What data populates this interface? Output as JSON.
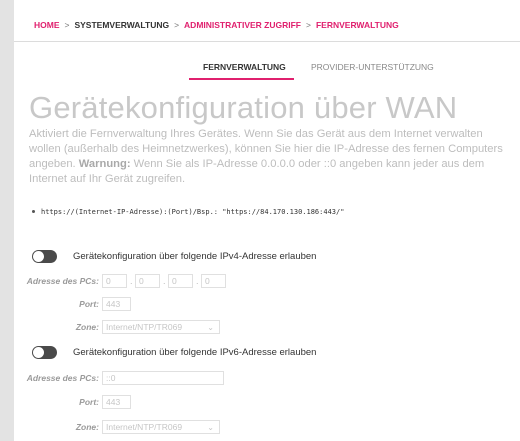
{
  "breadcrumb": {
    "home": "HOME",
    "item1": "SYSTEMVERWALTUNG",
    "item2": "ADMINISTRATIVER ZUGRIFF",
    "item3": "FERNVERWALTUNG",
    "separator": ">"
  },
  "tabs": [
    {
      "label": "FERNVERWALTUNG",
      "active": true
    },
    {
      "label": "PROVIDER-UNTERSTÜTZUNG",
      "active": false
    }
  ],
  "page": {
    "title": "Gerätekonfiguration über WAN",
    "description": "Aktiviert die Fernverwaltung Ihres Gerätes. Wenn Sie das Gerät aus dem Internet verwalten wollen (außerhalb des Heimnetzwerkes), können Sie hier die IP-Adresse des fernen Computers angeben.",
    "warning_label": "Warnung:",
    "warning_text": "Wenn Sie als IP-Adresse 0.0.0.0 oder ::0 angeben kann jeder aus dem Internet auf Ihr Gerät zugreifen.",
    "url_hint": "https://(Internet-IP-Adresse):(Port)/Bsp.: \"https://84.170.130.186:443/\""
  },
  "ipv4": {
    "toggle_label": "Gerätekonfiguration über folgende IPv4-Adresse erlauben",
    "enabled": false,
    "address_label": "Adresse des PCs:",
    "octets": [
      "0",
      "0",
      "0",
      "0"
    ],
    "port_label": "Port:",
    "port_placeholder": "443",
    "zone_label": "Zone:",
    "zone_value": "Internet/NTP/TR069"
  },
  "ipv6": {
    "toggle_label": "Gerätekonfiguration über folgende IPv6-Adresse erlauben",
    "enabled": false,
    "address_label": "Adresse des PCs:",
    "address_placeholder": "::0",
    "port_label": "Port:",
    "port_placeholder": "443",
    "zone_label": "Zone:",
    "zone_value": "Internet/NTP/TR069"
  },
  "colors": {
    "accent": "#e0206e",
    "background": "#e3e3e3",
    "panel": "#ffffff"
  }
}
